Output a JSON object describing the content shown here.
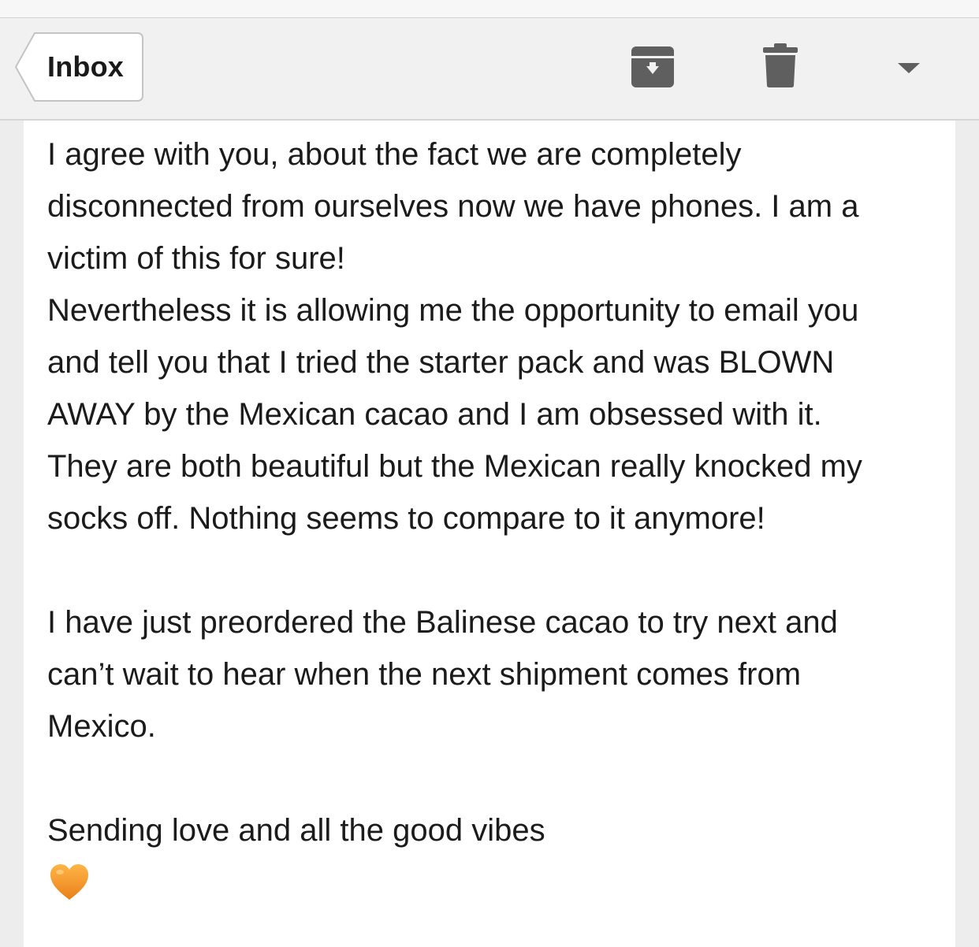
{
  "toolbar": {
    "back_label": "Inbox",
    "icons": [
      "archive-icon",
      "trash-icon",
      "more-dropdown-icon"
    ]
  },
  "email": {
    "paragraph1": [
      "I agree with you, about the fact we are completely",
      "disconnected from ourselves now we have phones. I am a",
      "victim of this for sure!",
      "Nevertheless it is allowing me the opportunity to email you",
      "and tell you that I tried the starter pack and was BLOWN",
      "AWAY by the Mexican cacao and I am obsessed with it.",
      "They are both beautiful but the Mexican really knocked my",
      "socks off. Nothing seems to compare to it anymore!"
    ],
    "paragraph2": [
      "I have just preordered the Balinese cacao to try next and",
      "can’t wait to hear when the next shipment comes from",
      "Mexico."
    ],
    "signoff": "Sending love and all the good vibes",
    "emoji": "orange-heart-emoji"
  },
  "colors": {
    "toolbar_bg": "#f1f1f1",
    "icon_gray": "#5f5f5f",
    "heart_orange": "#f39a1e"
  }
}
